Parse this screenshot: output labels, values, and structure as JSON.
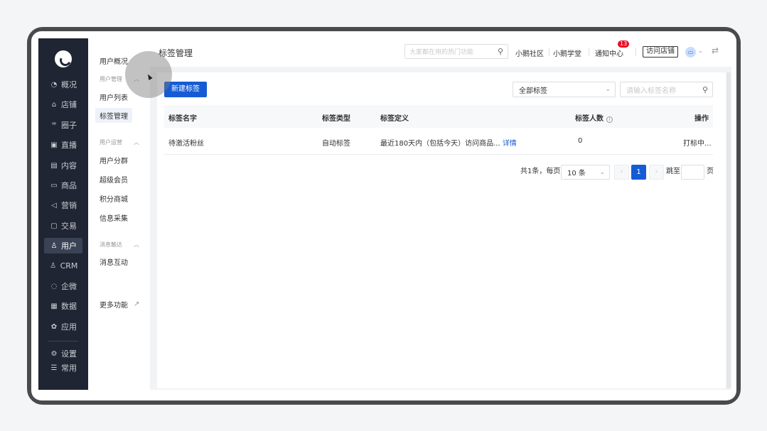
{
  "rail": {
    "items": [
      {
        "label": "概况",
        "icon": "◔"
      },
      {
        "label": "店铺",
        "icon": "⌂"
      },
      {
        "label": "圈子",
        "icon": "ꟹ"
      },
      {
        "label": "直播",
        "icon": "▣"
      },
      {
        "label": "内容",
        "icon": "▤"
      },
      {
        "label": "商品",
        "icon": "▭"
      },
      {
        "label": "营销",
        "icon": "◁"
      },
      {
        "label": "交易",
        "icon": "▢"
      },
      {
        "label": "用户",
        "icon": "♙"
      },
      {
        "label": "CRM",
        "icon": "♙"
      },
      {
        "label": "企微",
        "icon": "◌"
      },
      {
        "label": "数据",
        "icon": "▦"
      },
      {
        "label": "应用",
        "icon": "✿"
      },
      {
        "label": "设置",
        "icon": "⚙"
      },
      {
        "label": "常用",
        "icon": "☰"
      }
    ]
  },
  "subnav": {
    "overview": "用户概况",
    "group1": "用户管理",
    "user_list": "用户列表",
    "tag_mgmt": "标签管理",
    "group2": "用户运营",
    "segment": "用户分群",
    "vip": "超级会员",
    "points": "积分商城",
    "collect": "信息采集",
    "group3": "消息触达",
    "message": "消息互动",
    "more": "更多功能"
  },
  "header": {
    "title": "标签管理",
    "search_placeholder": "大家都在用的热门功能",
    "community": "小鹅社区",
    "academy": "小鹅学堂",
    "notice": "通知中心",
    "notice_badge": "13",
    "visit_shop": "访问店铺"
  },
  "toolbar": {
    "new_tag": "新建标签",
    "filter_select": "全部标签",
    "filter_placeholder": "请输入标签名称"
  },
  "table": {
    "columns": [
      "标签名字",
      "标签类型",
      "标签定义",
      "标签人数",
      "操作"
    ],
    "rows": [
      {
        "name": "待激活粉丝",
        "type": "自动标签",
        "definition": "最近180天内（包括今天）访问商品...",
        "detail": "详情",
        "count": "0",
        "action": "打标中..."
      }
    ]
  },
  "pagination": {
    "total": "共1条，每页",
    "page_size": "10 条",
    "current": "1",
    "jump_to": "跳至",
    "page_unit": "页"
  },
  "colors": {
    "primary": "#155bd4",
    "rail_bg": "#1f2532",
    "badge": "#ee0a24"
  }
}
